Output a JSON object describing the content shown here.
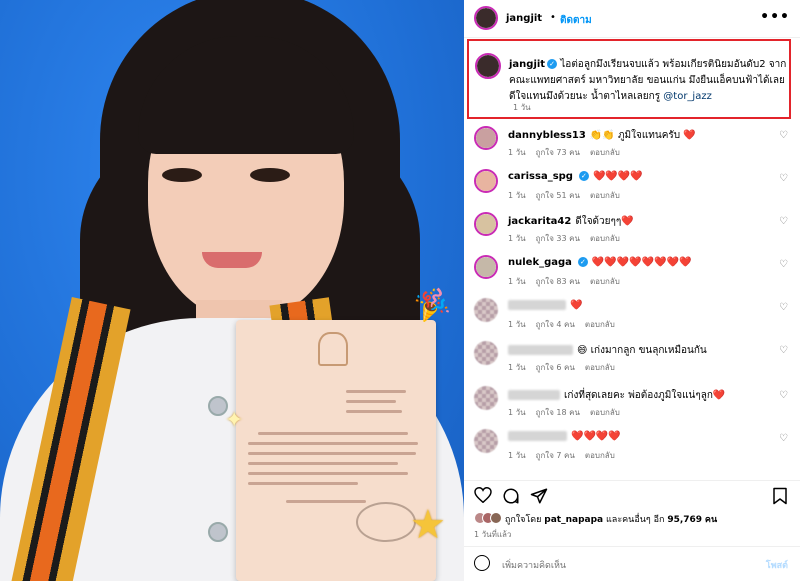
{
  "post": {
    "username": "jangjit",
    "follow_label": "ติดตาม",
    "separator": "•",
    "more_label": "•••"
  },
  "caption": {
    "username": "jangjit",
    "text": "ไอต่อลูกมึงเรียนจบแล้ว พร้อมเกียรตินิยมอันดับ2 จากคณะแพทยศาสตร์ มหาวิทยาลัย ขอนแก่น มึงยืนแอ็คบนฟ้าได้เลย ดีใจแทนมึงด้วยนะ น้ำตาไหลเลยกรู",
    "mention": "@tor_jazz",
    "time": "1 วัน"
  },
  "comments": [
    {
      "username": "dannybless13",
      "text": "👏👏 ภูมิใจแทนครับ ❤️",
      "time": "1 วัน",
      "likes": "ถูกใจ 73 คน",
      "reply": "ตอบกลับ",
      "verified": false,
      "anon": false
    },
    {
      "username": "carissa_spg",
      "text": "❤️❤️❤️❤️",
      "time": "1 วัน",
      "likes": "ถูกใจ 51 คน",
      "reply": "ตอบกลับ",
      "verified": true,
      "anon": false
    },
    {
      "username": "jackarita42",
      "text": "ดีใจด้วยๆๆ❤️",
      "time": "1 วัน",
      "likes": "ถูกใจ 33 คน",
      "reply": "ตอบกลับ",
      "verified": false,
      "anon": false
    },
    {
      "username": "nulek_gaga",
      "text": "❤️❤️❤️❤️❤️❤️❤️❤️",
      "time": "1 วัน",
      "likes": "ถูกใจ 83 คน",
      "reply": "ตอบกลับ",
      "verified": true,
      "anon": false
    },
    {
      "username": "",
      "text": "❤️",
      "time": "1 วัน",
      "likes": "ถูกใจ 4 คน",
      "reply": "ตอบกลับ",
      "verified": false,
      "anon": true
    },
    {
      "username": "",
      "text": "😄 เก่งมากลูก ขนลุกเหมือนกัน",
      "time": "1 วัน",
      "likes": "ถูกใจ 6 คน",
      "reply": "ตอบกลับ",
      "verified": false,
      "anon": true
    },
    {
      "username": "",
      "text": "เก่งที่สุดเลยคะ พ่อต้องภูมิใจแน่ๆลูก❤️",
      "time": "1 วัน",
      "likes": "ถูกใจ 18 คน",
      "reply": "ตอบกลับ",
      "verified": false,
      "anon": true
    },
    {
      "username": "",
      "text": "❤️❤️❤️❤️",
      "time": "1 วัน",
      "likes": "ถูกใจ 7 คน",
      "reply": "ตอบกลับ",
      "verified": false,
      "anon": true
    }
  ],
  "likes_summary": {
    "prefix": "ถูกใจโดย",
    "user": "pat_napapa",
    "middle": "และคนอื่นๆ อีก",
    "count": "95,769",
    "suffix": "คน"
  },
  "time_ago": "1 วันที่แล้ว",
  "add_comment": {
    "placeholder": "เพิ่มความคิดเห็น",
    "post_label": "โพสต์"
  },
  "icons": [
    "heart-icon",
    "comment-icon",
    "share-icon",
    "bookmark-icon",
    "emoji-icon",
    "verified-icon",
    "more-icon"
  ],
  "colors": {
    "accent": "#0095f6",
    "highlight_border": "#e3242b",
    "verified": "#1d9bf0",
    "photo_bg": "#1f73dc"
  }
}
